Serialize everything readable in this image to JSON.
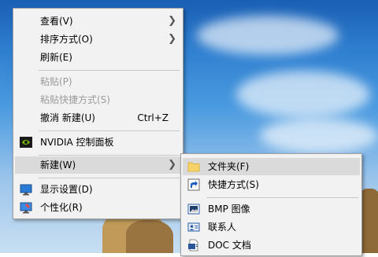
{
  "main_menu": {
    "items": [
      {
        "label": "查看(V)"
      },
      {
        "label": "排序方式(O)"
      },
      {
        "label": "刷新(E)"
      },
      {
        "label": "粘贴(P)"
      },
      {
        "label": "粘贴快捷方式(S)"
      },
      {
        "label": "撤消 新建(U)",
        "shortcut": "Ctrl+Z"
      },
      {
        "label": "NVIDIA 控制面板"
      },
      {
        "label": "新建(W)"
      },
      {
        "label": "显示设置(D)"
      },
      {
        "label": "个性化(R)"
      }
    ]
  },
  "submenu": {
    "items": [
      {
        "label": "文件夹(F)"
      },
      {
        "label": "快捷方式(S)"
      },
      {
        "label": "BMP 图像"
      },
      {
        "label": "联系人"
      },
      {
        "label": "DOC 文档"
      }
    ]
  },
  "colors": {
    "menu_bg": "#f2f2f2",
    "highlight": "#dadada",
    "disabled_text": "#9a9a9a"
  }
}
